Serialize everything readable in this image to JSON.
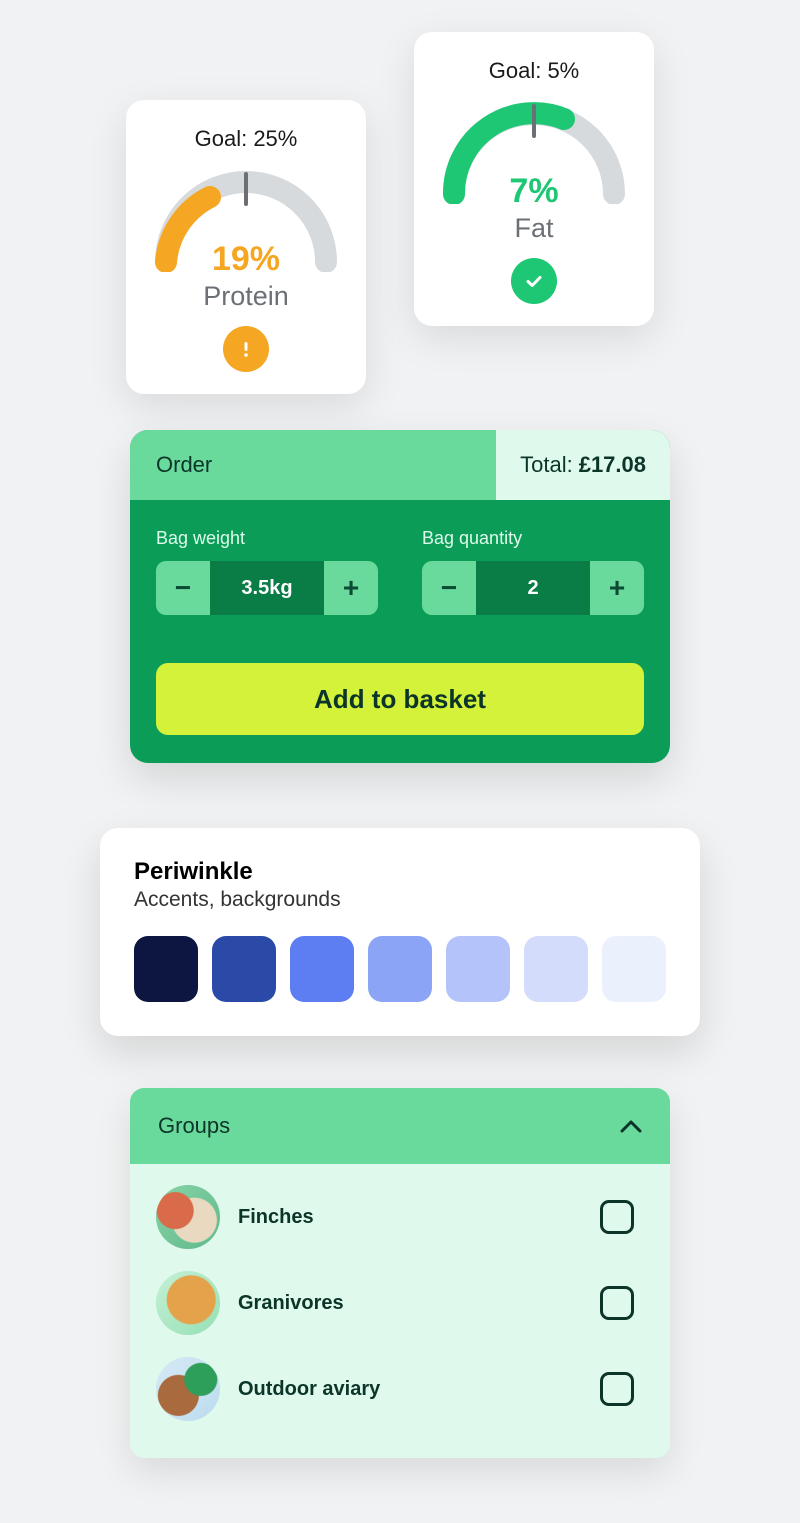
{
  "gauges": {
    "protein": {
      "goal_label": "Goal: 25%",
      "value_label": "19%",
      "name_label": "Protein",
      "value": 19,
      "goal": 25,
      "color": "#f5a623",
      "status": "warning"
    },
    "fat": {
      "goal_label": "Goal: 5%",
      "value_label": "7%",
      "name_label": "Fat",
      "value": 7,
      "goal": 5,
      "color": "#1ec773",
      "status": "ok"
    }
  },
  "order": {
    "title": "Order",
    "total_label": "Total:",
    "total_value": "£17.08",
    "bag_weight_label": "Bag weight",
    "bag_weight_value": "3.5kg",
    "bag_qty_label": "Bag quantity",
    "bag_qty_value": "2",
    "add_label": "Add to basket"
  },
  "palette": {
    "title": "Periwinkle",
    "subtitle": "Accents, backgrounds",
    "colors": [
      "#0d1640",
      "#2b4aa8",
      "#5c7ef2",
      "#8ba4f6",
      "#b4c4fa",
      "#d4dcfb",
      "#ebf0fd"
    ]
  },
  "groups": {
    "title": "Groups",
    "items": [
      {
        "label": "Finches"
      },
      {
        "label": "Granivores"
      },
      {
        "label": "Outdoor aviary"
      }
    ]
  },
  "chart_data": [
    {
      "type": "gauge",
      "title": "Protein",
      "value": 19,
      "goal": 25,
      "unit": "%",
      "range": [
        0,
        50
      ],
      "status": "below-goal"
    },
    {
      "type": "gauge",
      "title": "Fat",
      "value": 7,
      "goal": 5,
      "unit": "%",
      "range": [
        0,
        10
      ],
      "status": "met"
    }
  ]
}
